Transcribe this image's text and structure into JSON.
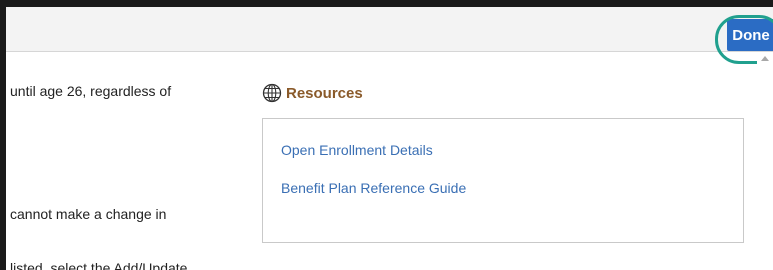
{
  "header": {
    "done_label": "Done"
  },
  "content": {
    "line_1": "until age 26, regardless of",
    "line_2": "cannot make a change in",
    "line_3": "listed, select the Add/Update"
  },
  "resources": {
    "title": "Resources",
    "icon": "globe-icon",
    "links": [
      {
        "label": "Open Enrollment Details"
      },
      {
        "label": "Benefit Plan Reference Guide"
      }
    ]
  },
  "colors": {
    "done_button": "#2b6cc4",
    "highlight_ring": "#20a08e",
    "resources_title": "#8a5a2a",
    "link": "#3a6fb4"
  }
}
